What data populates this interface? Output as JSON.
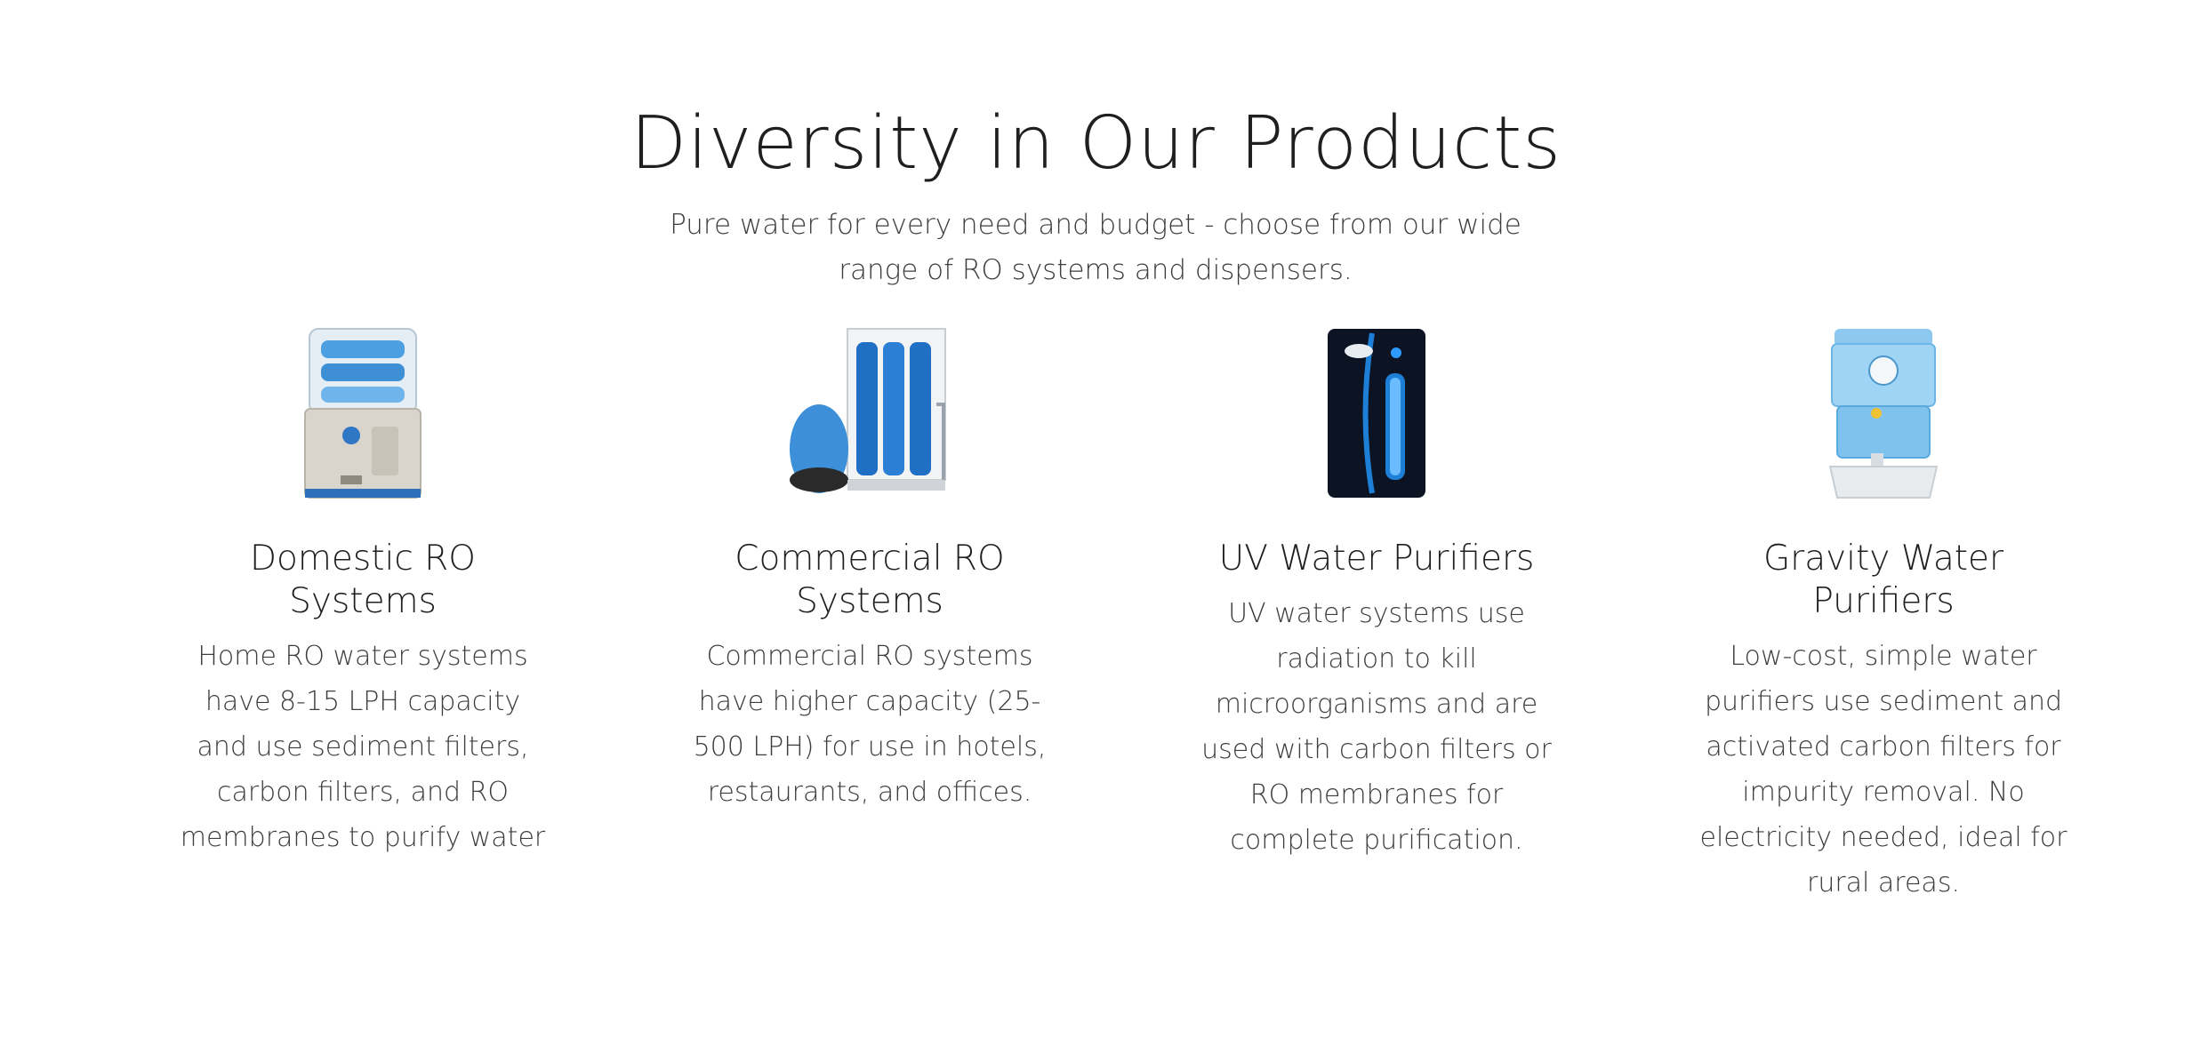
{
  "section": {
    "heading": "Diversity in Our Products",
    "subtitle": "Pure water for every need and budget - choose from our wide range of RO systems and dispensers."
  },
  "products": [
    {
      "icon": "domestic-ro-purifier-image",
      "title": "Domestic RO Systems",
      "description": "Home RO water systems have 8-15 LPH capacity and use sediment filters, carbon filters, and RO membranes to purify water"
    },
    {
      "icon": "commercial-ro-plant-image",
      "title": "Commercial RO Systems",
      "description": "Commercial RO systems have higher capacity (25-500 LPH) for use in hotels, restaurants, and offices."
    },
    {
      "icon": "uv-purifier-image",
      "title": "UV Water Purifiers",
      "description": "UV water systems use radiation to kill microorganisms and are used with carbon filters or RO membranes for complete purification."
    },
    {
      "icon": "gravity-purifier-image",
      "title": "Gravity Water Purifiers",
      "description": "Low-cost, simple water purifiers use sediment and activated carbon filters for impurity removal. No electricity needed, ideal for rural areas."
    }
  ],
  "colors": {
    "heading": "#1f1f1f",
    "body_text": "#3d3d3d",
    "product_blue": "#1e7fd6",
    "background": "#ffffff"
  }
}
